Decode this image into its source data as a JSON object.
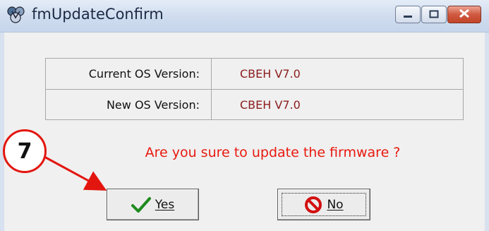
{
  "window": {
    "title": "fmUpdateConfirm",
    "icons": {
      "app": "app-logo-icon",
      "minimize": "minimize-icon",
      "maximize": "maximize-icon",
      "close": "close-icon"
    }
  },
  "table": {
    "rows": [
      {
        "label": "Current OS Version:",
        "value": "CBEH V7.0"
      },
      {
        "label": "New OS Version:",
        "value": "CBEH V7.0"
      }
    ]
  },
  "question": "Are you sure to update the firmware ?",
  "buttons": {
    "yes": {
      "label": "Yes",
      "icon": "checkmark-icon"
    },
    "no": {
      "label": "No",
      "icon": "prohibited-icon"
    }
  },
  "annotation": {
    "step_number": "7",
    "color": "#e3160f"
  },
  "colors": {
    "question": "#e8190f",
    "value_text": "#8b1c1c",
    "close_button": "#c24427"
  }
}
